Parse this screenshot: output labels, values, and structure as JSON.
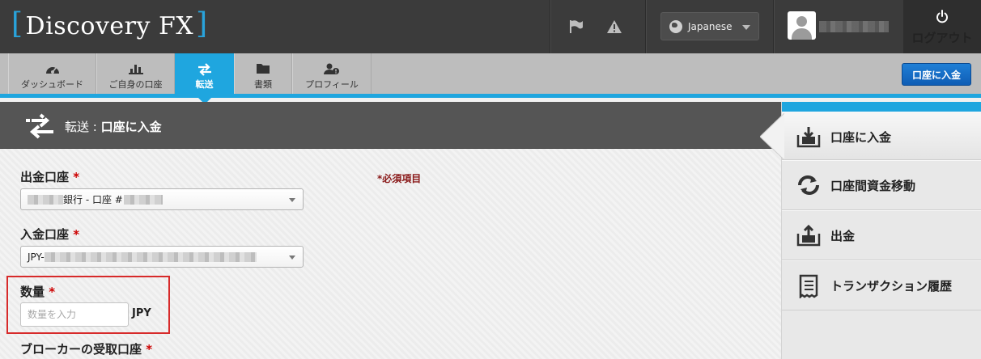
{
  "header": {
    "logo_text": "Discovery FX",
    "logo_bracket_left": "[",
    "logo_bracket_right": "]",
    "language": "Japanese",
    "logout_label": "ログアウト"
  },
  "tabs": [
    {
      "label": "ダッシュボード",
      "icon": "dashboard-icon"
    },
    {
      "label": "ご自身の口座",
      "icon": "bar-chart-icon"
    },
    {
      "label": "転送",
      "icon": "transfer-icon"
    },
    {
      "label": "書類",
      "icon": "folder-icon"
    },
    {
      "label": "プロフィール",
      "icon": "profile-icon"
    }
  ],
  "deposit_button_label": "口座に入金",
  "page": {
    "section": "転送 : ",
    "title": "口座に入金"
  },
  "form": {
    "required_note": "*必須項目",
    "from_account": {
      "label": "出金口座",
      "asterisk": "*",
      "value_mid": "銀行 - 口座 #"
    },
    "to_account": {
      "label": "入金口座",
      "asterisk": "*",
      "value_prefix": "JPY-"
    },
    "quantity": {
      "label": "数量",
      "asterisk": "*",
      "placeholder": "数量を入力",
      "unit": "JPY"
    },
    "broker_account": {
      "label": "ブローカーの受取口座",
      "asterisk": "*"
    }
  },
  "side_menu": [
    {
      "label": "口座に入金",
      "icon": "deposit-icon",
      "active": true
    },
    {
      "label": "口座間資金移動",
      "icon": "exchange-icon",
      "active": false
    },
    {
      "label": "出金",
      "icon": "withdraw-icon",
      "active": false
    },
    {
      "label": "トランザクション履歴",
      "icon": "receipt-icon",
      "active": false
    }
  ],
  "colors": {
    "accent": "#1fa6df",
    "header_bg": "#3b3b3b",
    "button_blue": "#1565c0",
    "required_red": "#c00000"
  }
}
